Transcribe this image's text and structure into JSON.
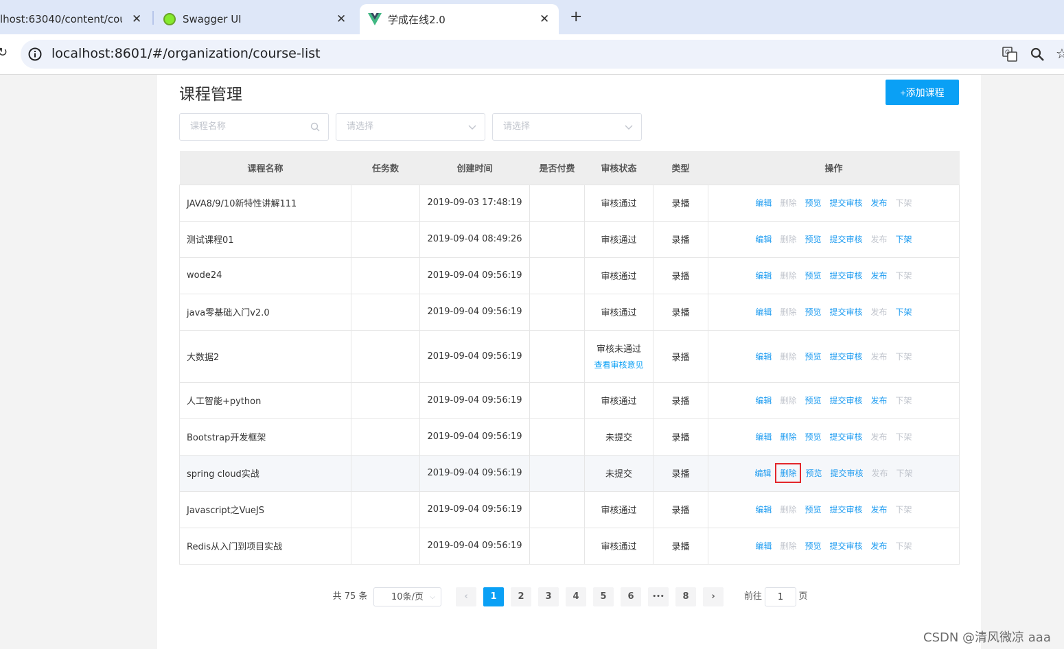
{
  "browser": {
    "tabs": [
      {
        "title": "lhost:63040/content/cou",
        "close": "✕"
      },
      {
        "title": "Swagger UI",
        "close": "✕"
      },
      {
        "title": "学成在线2.0",
        "close": "✕"
      }
    ],
    "new_tab": "+",
    "url": "localhost:8601/#/organization/course-list"
  },
  "page": {
    "title": "课程管理",
    "add_button": "+添加课程"
  },
  "filters": {
    "name_placeholder": "课程名称",
    "select1_placeholder": "请选择",
    "select2_placeholder": "请选择"
  },
  "table": {
    "headers": [
      "课程名称",
      "任务数",
      "创建时间",
      "是否付费",
      "审核状态",
      "类型",
      "操作"
    ],
    "rows": [
      {
        "name": "JAVA8/9/10新特性讲解111",
        "tasks": "",
        "created": "2019-09-03 17:48:19",
        "paid": "",
        "status": "审核通过",
        "status_link": "",
        "type": "录播",
        "acts": {
          "edit": "编辑",
          "del": "删除",
          "preview": "预览",
          "submit": "提交审核",
          "publish": "发布",
          "offline": "下架"
        }
      },
      {
        "name": "测试课程01",
        "tasks": "",
        "created": "2019-09-04 08:49:26",
        "paid": "",
        "status": "审核通过",
        "status_link": "",
        "type": "录播",
        "acts": {
          "edit": "编辑",
          "del": "删除",
          "preview": "预览",
          "submit": "提交审核",
          "publish": "发布",
          "offline": "下架"
        }
      },
      {
        "name": "wode24",
        "tasks": "",
        "created": "2019-09-04 09:56:19",
        "paid": "",
        "status": "审核通过",
        "status_link": "",
        "type": "录播",
        "acts": {
          "edit": "编辑",
          "del": "删除",
          "preview": "预览",
          "submit": "提交审核",
          "publish": "发布",
          "offline": "下架"
        }
      },
      {
        "name": "java零基础入门v2.0",
        "tasks": "",
        "created": "2019-09-04 09:56:19",
        "paid": "",
        "status": "审核通过",
        "status_link": "",
        "type": "录播",
        "acts": {
          "edit": "编辑",
          "del": "删除",
          "preview": "预览",
          "submit": "提交审核",
          "publish": "发布",
          "offline": "下架"
        }
      },
      {
        "name": "大数据2",
        "tasks": "",
        "created": "2019-09-04 09:56:19",
        "paid": "",
        "status": "审核未通过",
        "status_link": "查看审核意见",
        "type": "录播",
        "acts": {
          "edit": "编辑",
          "del": "删除",
          "preview": "预览",
          "submit": "提交审核",
          "publish": "发布",
          "offline": "下架"
        }
      },
      {
        "name": "人工智能+python",
        "tasks": "",
        "created": "2019-09-04 09:56:19",
        "paid": "",
        "status": "审核通过",
        "status_link": "",
        "type": "录播",
        "acts": {
          "edit": "编辑",
          "del": "删除",
          "preview": "预览",
          "submit": "提交审核",
          "publish": "发布",
          "offline": "下架"
        }
      },
      {
        "name": "Bootstrap开发框架",
        "tasks": "",
        "created": "2019-09-04 09:56:19",
        "paid": "",
        "status": "未提交",
        "status_link": "",
        "type": "录播",
        "acts": {
          "edit": "编辑",
          "del": "删除",
          "preview": "预览",
          "submit": "提交审核",
          "publish": "发布",
          "offline": "下架"
        }
      },
      {
        "name": "spring cloud实战",
        "tasks": "",
        "created": "2019-09-04 09:56:19",
        "paid": "",
        "status": "未提交",
        "status_link": "",
        "type": "录播",
        "acts": {
          "edit": "编辑",
          "del": "删除",
          "preview": "预览",
          "submit": "提交审核",
          "publish": "发布",
          "offline": "下架"
        }
      },
      {
        "name": "Javascript之VueJS",
        "tasks": "",
        "created": "2019-09-04 09:56:19",
        "paid": "",
        "status": "审核通过",
        "status_link": "",
        "type": "录播",
        "acts": {
          "edit": "编辑",
          "del": "删除",
          "preview": "预览",
          "submit": "提交审核",
          "publish": "发布",
          "offline": "下架"
        }
      },
      {
        "name": "Redis从入门到项目实战",
        "tasks": "",
        "created": "2019-09-04 09:56:19",
        "paid": "",
        "status": "审核通过",
        "status_link": "",
        "type": "录播",
        "acts": {
          "edit": "编辑",
          "del": "删除",
          "preview": "预览",
          "submit": "提交审核",
          "publish": "发布",
          "offline": "下架"
        }
      }
    ]
  },
  "pagination": {
    "total": "共 75 条",
    "page_size": "10条/页",
    "pages": [
      "1",
      "2",
      "3",
      "4",
      "5",
      "6",
      "•••",
      "8"
    ],
    "prev": "‹",
    "next": "›",
    "goto_label": "前往",
    "goto_value": "1",
    "goto_suffix": "页"
  },
  "watermark": "CSDN @清风微凉 aaa",
  "colors": {
    "accent": "#0aa0f5",
    "highlight": "#e3262b"
  }
}
